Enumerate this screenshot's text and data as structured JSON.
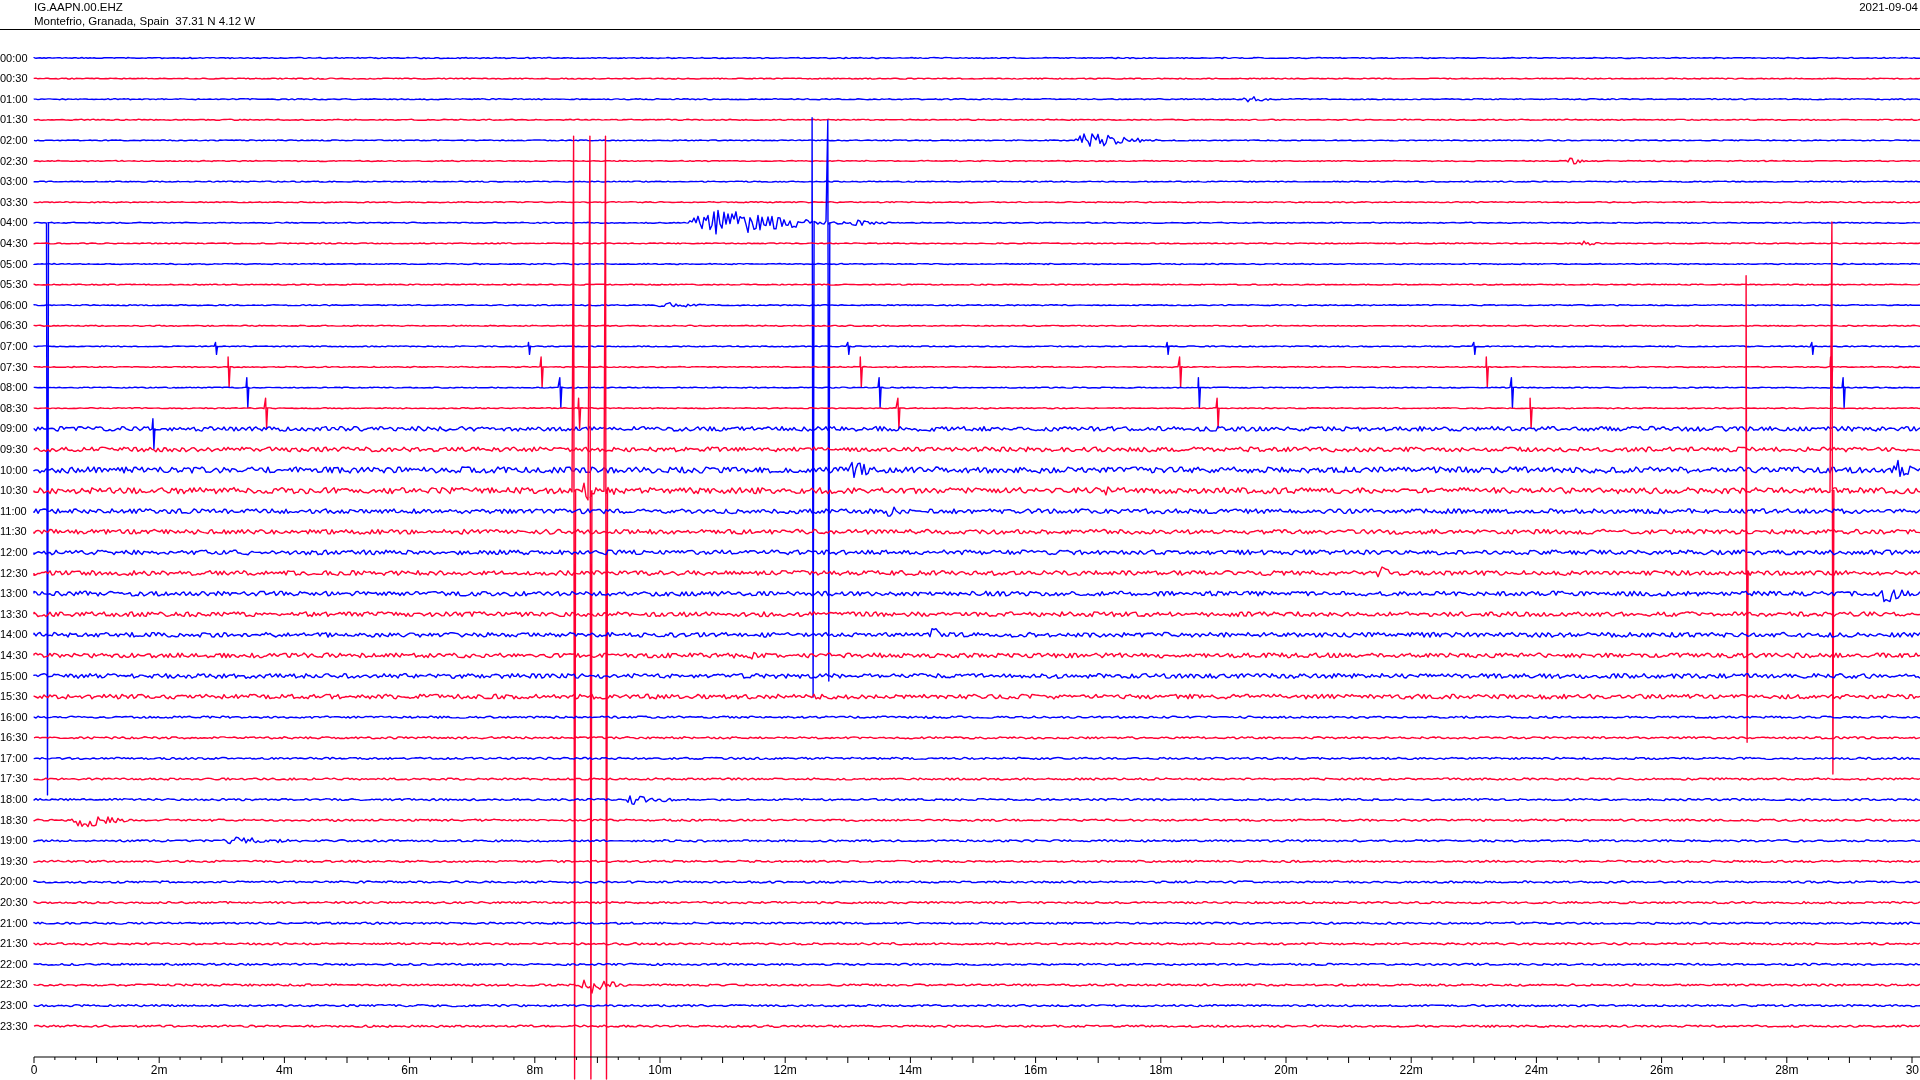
{
  "header": {
    "station": "IG.AAPN.00.EHZ",
    "location": "Montefrio, Granada, Spain  37.31 N 4.12 W",
    "date": "2021-09-04"
  },
  "rows": [
    {
      "label": "00:00",
      "color": "#0000ff"
    },
    {
      "label": "00:30",
      "color": "#ff0033"
    },
    {
      "label": "01:00",
      "color": "#0000ff"
    },
    {
      "label": "01:30",
      "color": "#ff0033"
    },
    {
      "label": "02:00",
      "color": "#0000ff"
    },
    {
      "label": "02:30",
      "color": "#ff0033"
    },
    {
      "label": "03:00",
      "color": "#0000ff"
    },
    {
      "label": "03:30",
      "color": "#ff0033"
    },
    {
      "label": "04:00",
      "color": "#0000ff"
    },
    {
      "label": "04:30",
      "color": "#ff0033"
    },
    {
      "label": "05:00",
      "color": "#0000ff"
    },
    {
      "label": "05:30",
      "color": "#ff0033"
    },
    {
      "label": "06:00",
      "color": "#0000ff"
    },
    {
      "label": "06:30",
      "color": "#ff0033"
    },
    {
      "label": "07:00",
      "color": "#0000ff"
    },
    {
      "label": "07:30",
      "color": "#ff0033"
    },
    {
      "label": "08:00",
      "color": "#0000ff"
    },
    {
      "label": "08:30",
      "color": "#ff0033"
    },
    {
      "label": "09:00",
      "color": "#0000ff"
    },
    {
      "label": "09:30",
      "color": "#ff0033"
    },
    {
      "label": "10:00",
      "color": "#0000ff"
    },
    {
      "label": "10:30",
      "color": "#ff0033"
    },
    {
      "label": "11:00",
      "color": "#0000ff"
    },
    {
      "label": "11:30",
      "color": "#ff0033"
    },
    {
      "label": "12:00",
      "color": "#0000ff"
    },
    {
      "label": "12:30",
      "color": "#ff0033"
    },
    {
      "label": "13:00",
      "color": "#0000ff"
    },
    {
      "label": "13:30",
      "color": "#ff0033"
    },
    {
      "label": "14:00",
      "color": "#0000ff"
    },
    {
      "label": "14:30",
      "color": "#ff0033"
    },
    {
      "label": "15:00",
      "color": "#0000ff"
    },
    {
      "label": "15:30",
      "color": "#ff0033"
    },
    {
      "label": "16:00",
      "color": "#0000ff"
    },
    {
      "label": "16:30",
      "color": "#ff0033"
    },
    {
      "label": "17:00",
      "color": "#0000ff"
    },
    {
      "label": "17:30",
      "color": "#ff0033"
    },
    {
      "label": "18:00",
      "color": "#0000ff"
    },
    {
      "label": "18:30",
      "color": "#ff0033"
    },
    {
      "label": "19:00",
      "color": "#0000ff"
    },
    {
      "label": "19:30",
      "color": "#ff0033"
    },
    {
      "label": "20:00",
      "color": "#0000ff"
    },
    {
      "label": "20:30",
      "color": "#ff0033"
    },
    {
      "label": "21:00",
      "color": "#0000ff"
    },
    {
      "label": "21:30",
      "color": "#ff0033"
    },
    {
      "label": "22:00",
      "color": "#0000ff"
    },
    {
      "label": "22:30",
      "color": "#ff0033"
    },
    {
      "label": "23:00",
      "color": "#0000ff"
    },
    {
      "label": "23:30",
      "color": "#ff0033"
    }
  ],
  "time_axis": {
    "labels": [
      "0",
      "2m",
      "4m",
      "6m",
      "8m",
      "10m",
      "12m",
      "14m",
      "16m",
      "18m",
      "20m",
      "22m",
      "24m",
      "26m",
      "28m",
      "30"
    ]
  }
}
